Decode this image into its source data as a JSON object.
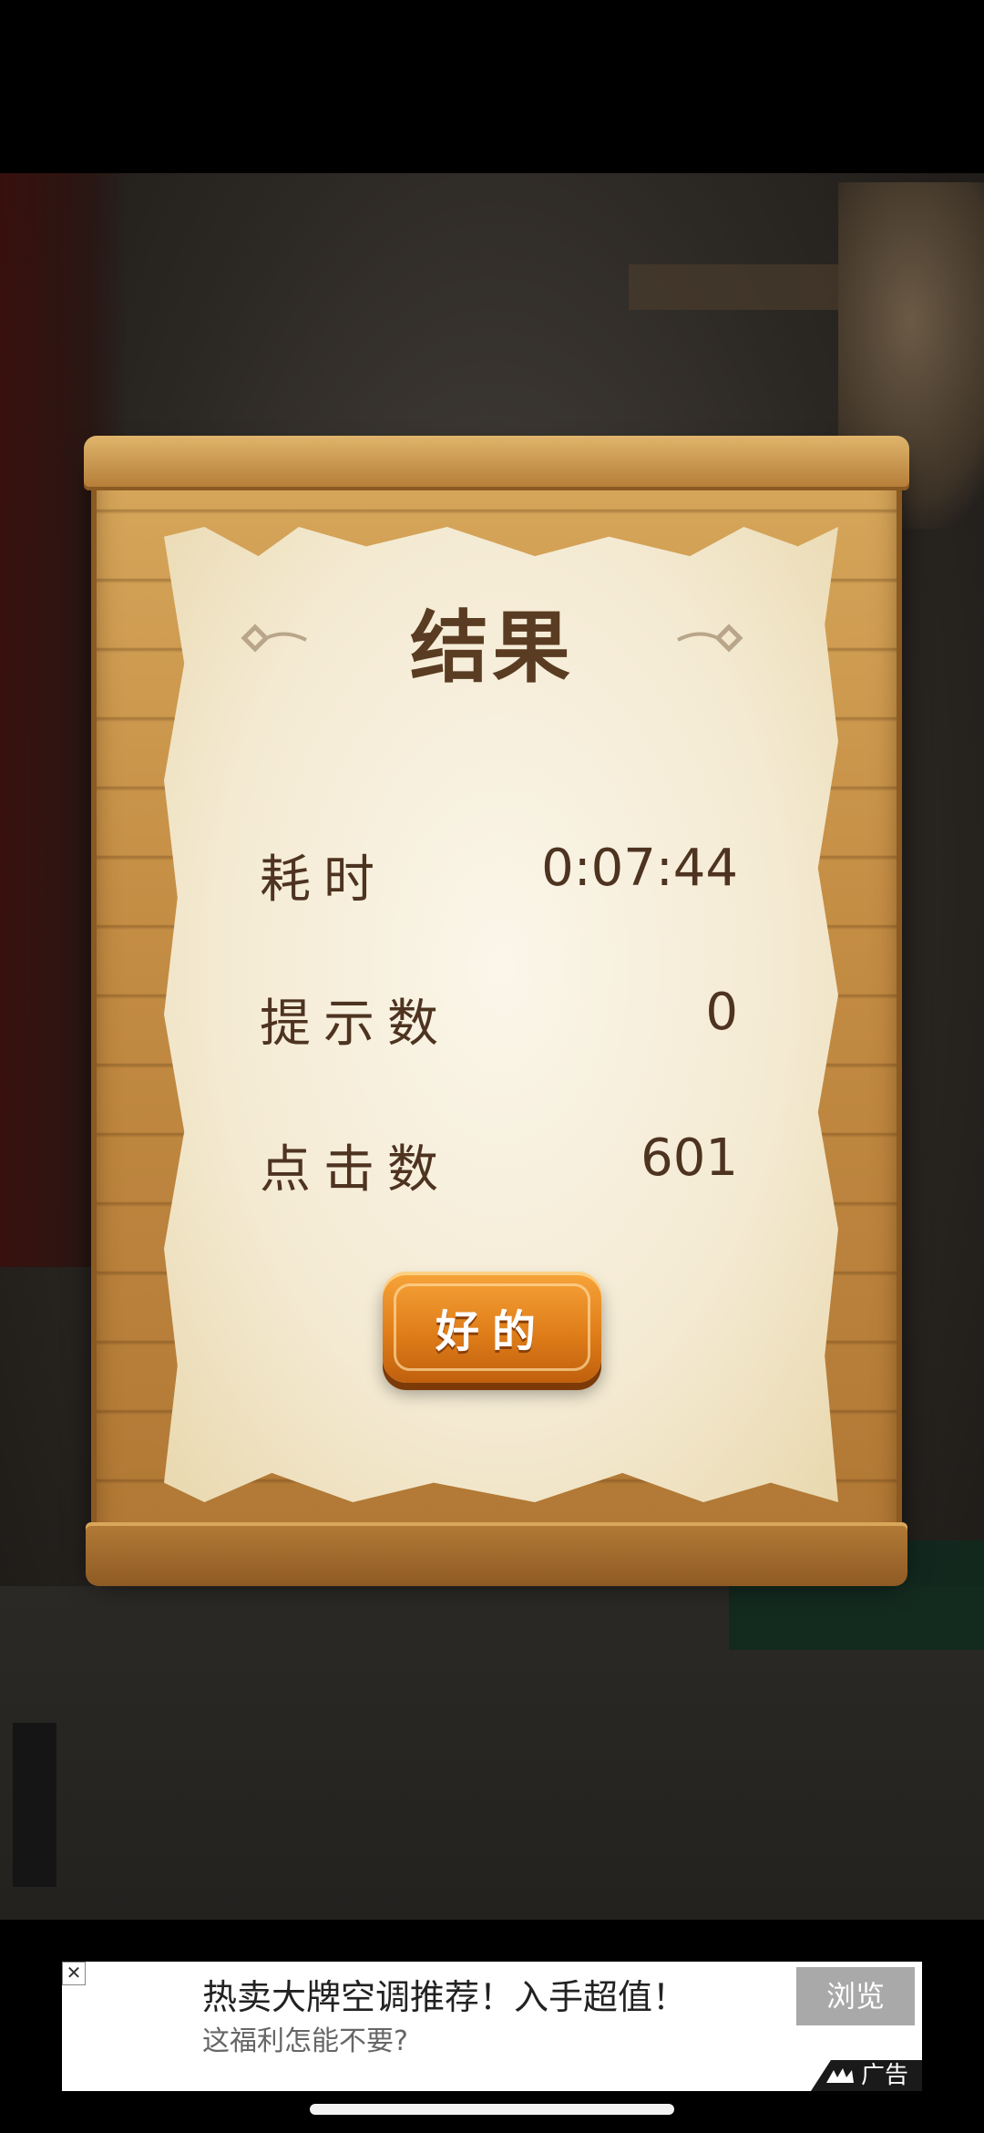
{
  "result_panel": {
    "title": "结果",
    "stats": [
      {
        "label": "耗时",
        "value": "0:07:44"
      },
      {
        "label": "提示数",
        "value": "0"
      },
      {
        "label": "点击数",
        "value": "601"
      }
    ],
    "ok_label": "好的"
  },
  "ad": {
    "title": "热卖大牌空调推荐！入手超值！",
    "subtitle": "这福利怎能不要?",
    "browse_label": "浏览",
    "tag_label": "广告",
    "close_icon": "close-icon"
  },
  "colors": {
    "panel_text": "#4d3320",
    "button_orange": "#e07e1a",
    "parchment": "#f4ead2",
    "wood": "#c58e45"
  }
}
